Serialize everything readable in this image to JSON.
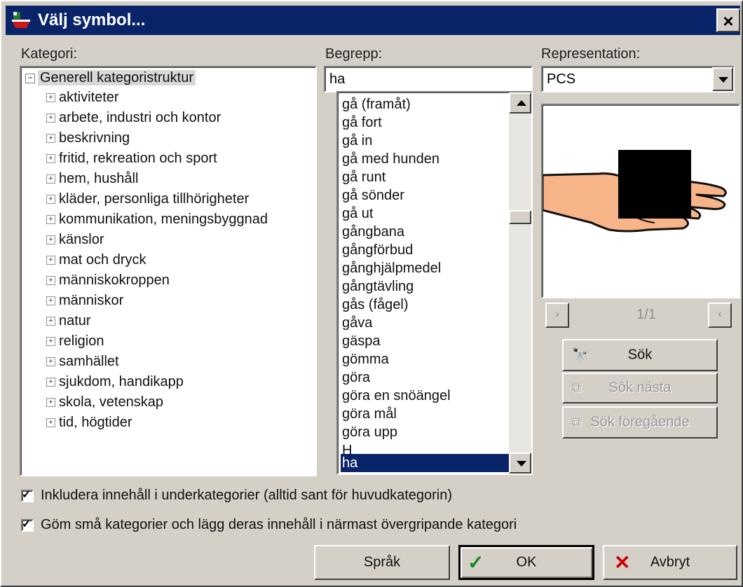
{
  "window": {
    "title": "Välj symbol...",
    "close_glyph": "×"
  },
  "labels": {
    "kategori": "Kategori:",
    "begrepp": "Begrepp:",
    "representation": "Representation:"
  },
  "tree": {
    "root_toggle": "−",
    "root_label": "Generell kategoristruktur",
    "expand_glyph": "+",
    "items": [
      "aktiviteter",
      "arbete, industri och kontor",
      "beskrivning",
      "fritid, rekreation och sport",
      "hem, hushåll",
      "kläder, personliga tillhörigheter",
      "kommunikation, meningsbyggnad",
      "känslor",
      "mat och dryck",
      "människokroppen",
      "människor",
      "natur",
      "religion",
      "samhället",
      "sjukdom, handikapp",
      "skola, vetenskap",
      "tid, högtider"
    ]
  },
  "search": {
    "value": "ha"
  },
  "concepts": {
    "items": [
      "gå (framåt)",
      "gå fort",
      "gå in",
      "gå med hunden",
      "gå runt",
      "gå sönder",
      "gå ut",
      "gångbana",
      "gångförbud",
      "gånghjälpmedel",
      "gångtävling",
      "gås (fågel)",
      "gåva",
      "gäspa",
      "gömma",
      "göra",
      "göra en snöängel",
      "göra mål",
      "göra upp",
      "H",
      "ha"
    ],
    "selected": "ha"
  },
  "representation": {
    "selected": "PCS",
    "page_indicator": "1/1",
    "prev_glyph": "›",
    "next_glyph": "‹"
  },
  "buttons": {
    "sok": "Sök",
    "sok_nasta": "Sök nästa",
    "sok_foregaende": "Sök föregående",
    "sprak": "Språk",
    "ok": "OK",
    "avbryt": "Avbryt"
  },
  "checkboxes": {
    "include_sub": {
      "label": "Inkludera innehåll i underkategorier (alltid sant för huvudkategorin)",
      "checked": true
    },
    "hide_small": {
      "label": "Göm små kategorier och lägg deras innehåll i närmast övergripande kategori",
      "checked": true
    }
  },
  "colors": {
    "title_bg": "#0a246a",
    "selection_bg": "#0a246a",
    "skin": "#f7b489",
    "ok_check": "#1a8a1a",
    "cancel_x": "#cc0000"
  }
}
